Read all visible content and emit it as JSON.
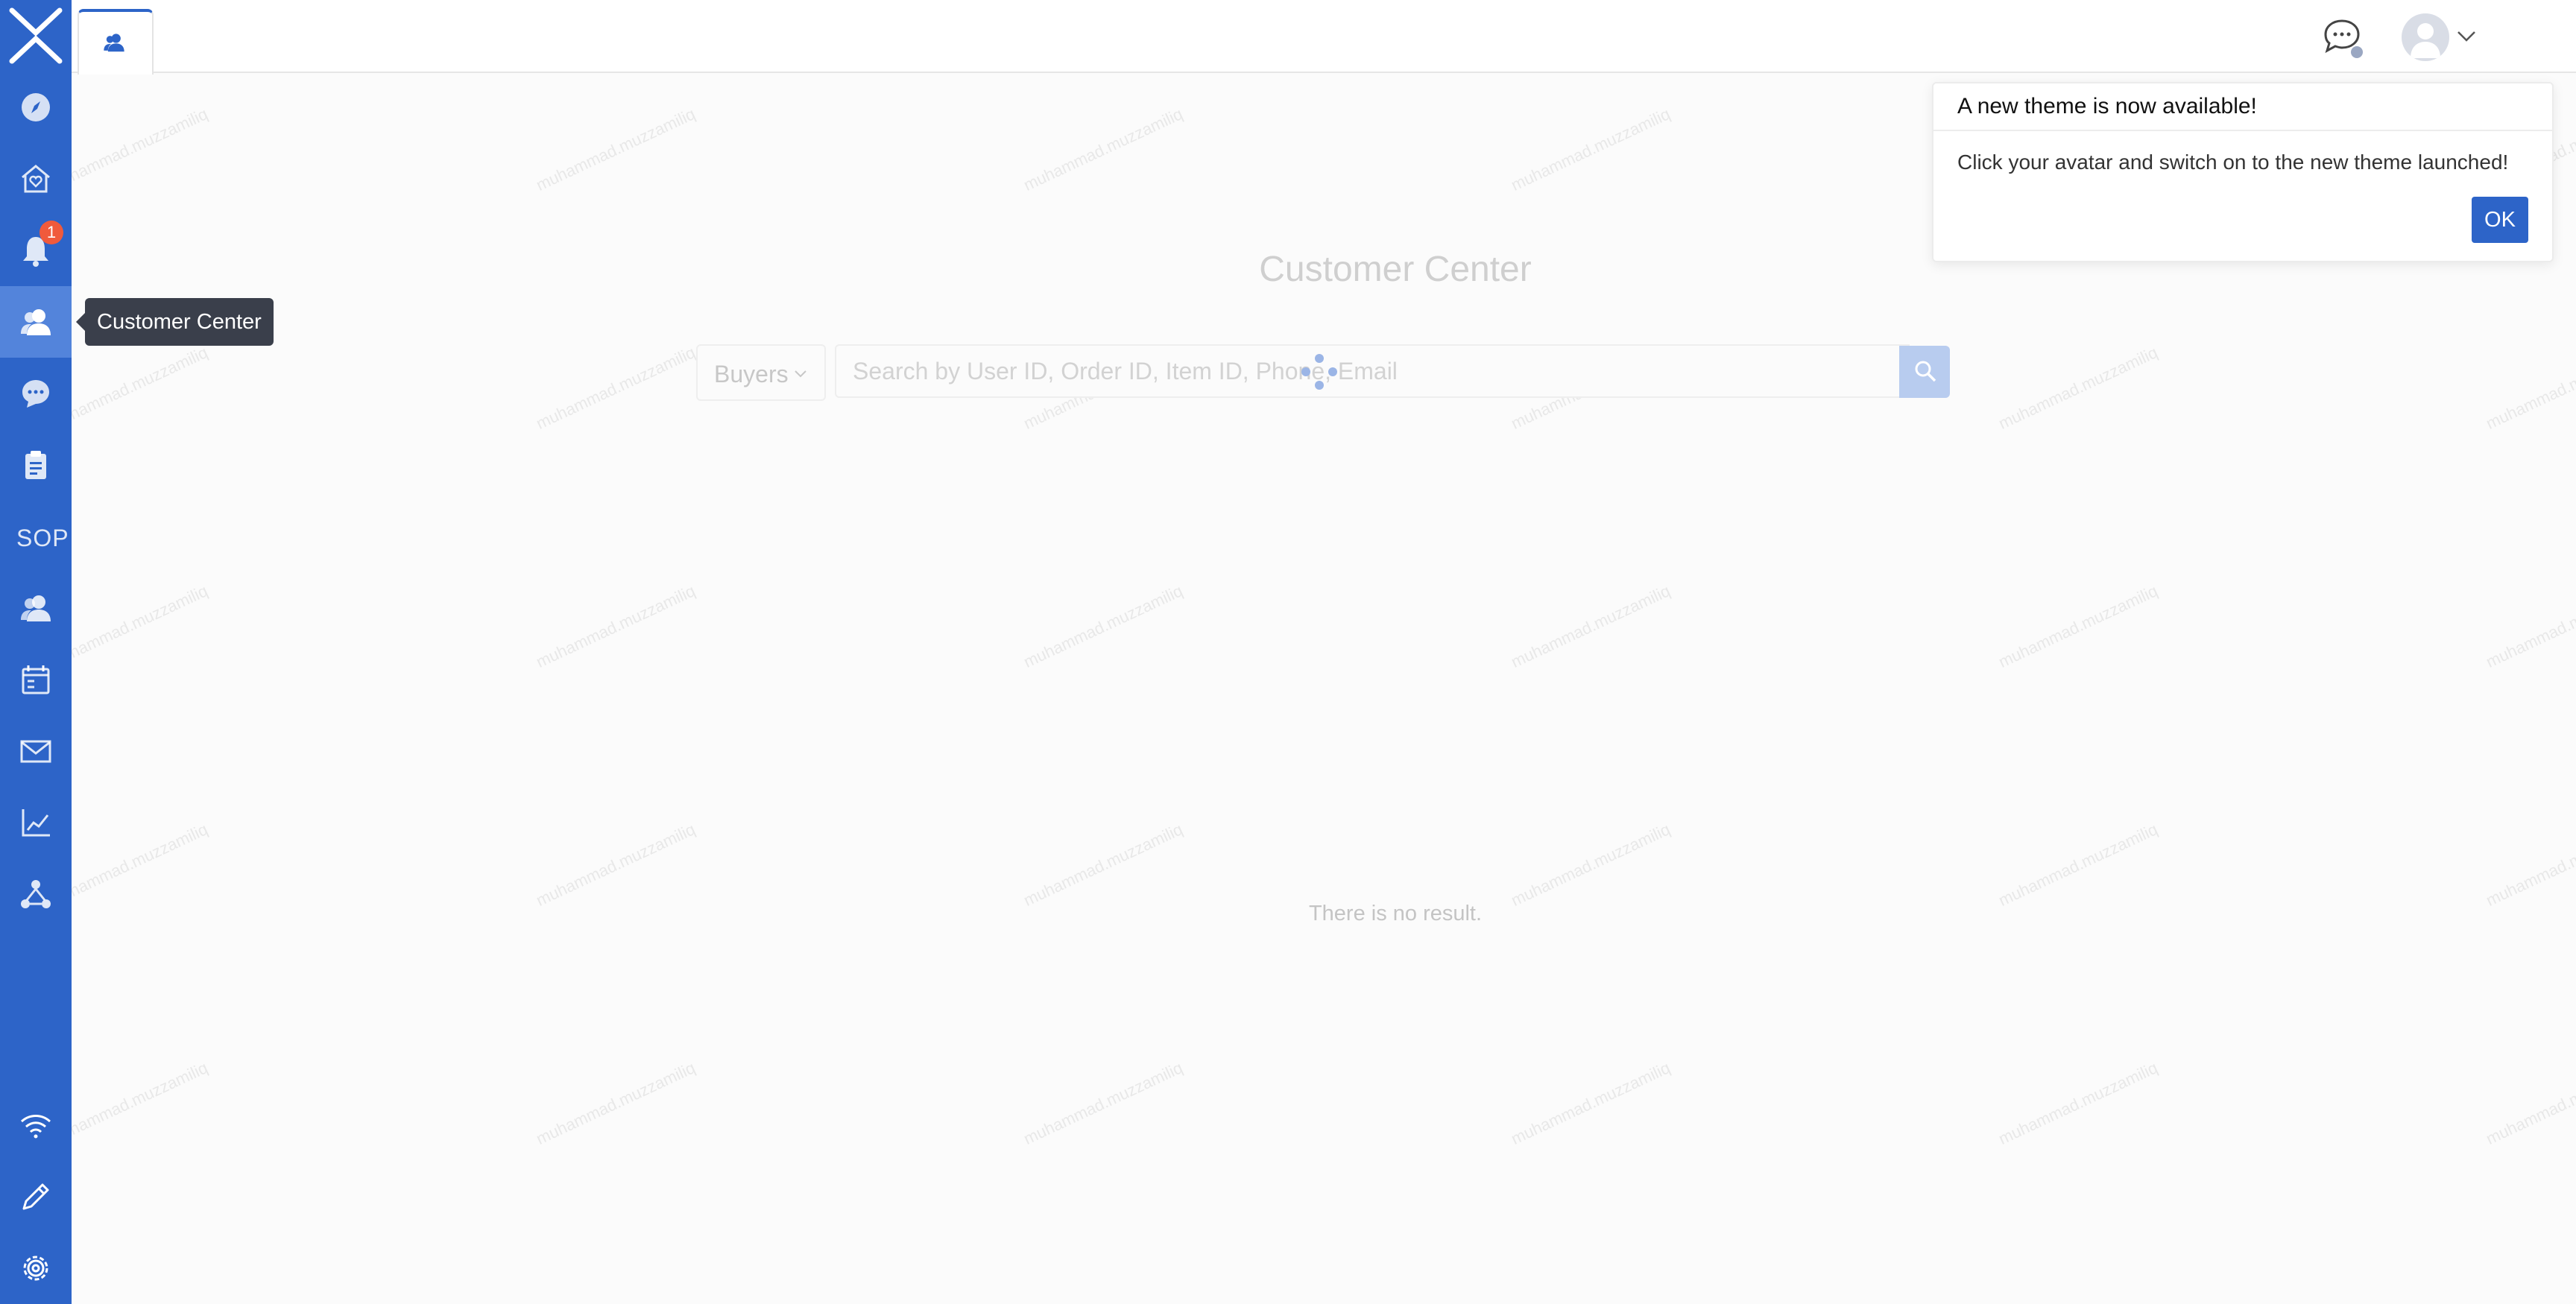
{
  "sidebar": {
    "badge_count": "1",
    "sop_label": "SOP",
    "items": [
      {
        "name": "explore"
      },
      {
        "name": "home-heart"
      },
      {
        "name": "notifications"
      },
      {
        "name": "customer-center"
      },
      {
        "name": "chat"
      },
      {
        "name": "clipboard"
      },
      {
        "name": "sop"
      },
      {
        "name": "users"
      },
      {
        "name": "calendar"
      },
      {
        "name": "mail"
      },
      {
        "name": "analytics"
      },
      {
        "name": "workflow"
      },
      {
        "name": "wifi"
      },
      {
        "name": "edit"
      },
      {
        "name": "settings"
      }
    ],
    "accent": "#2d64c8",
    "active_bg": "#5384db"
  },
  "tooltip": {
    "text": "Customer Center"
  },
  "topbar": {
    "tab_icon": "users-icon"
  },
  "main": {
    "title": "Customer Center",
    "select_value": "Buyers",
    "search_placeholder": "Search by User ID, Order ID, Item ID, Phone, Email",
    "empty_text": "There is no result.",
    "watermark_text": "muhammad.muzzamiliq"
  },
  "popover": {
    "title": "A new theme is now available!",
    "body": "Click your avatar and switch on to the new theme launched!",
    "ok_label": "OK"
  }
}
